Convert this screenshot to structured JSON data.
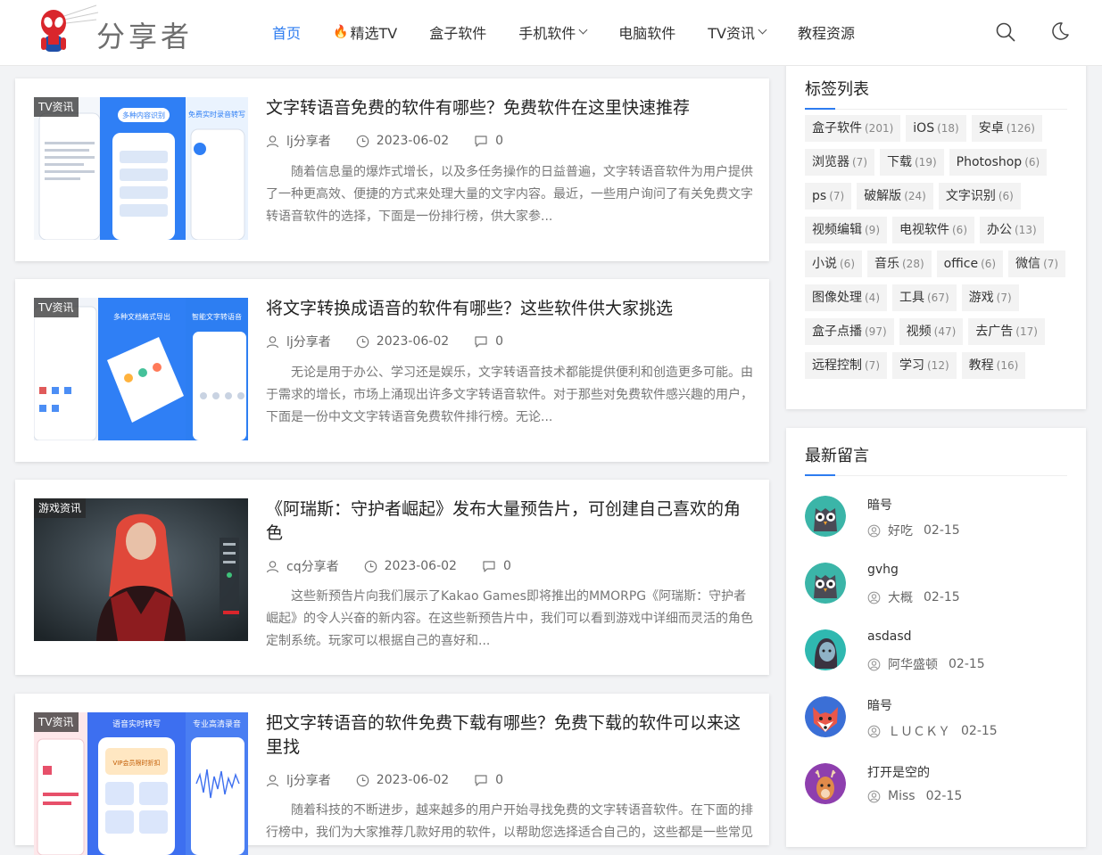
{
  "header": {
    "logo_text": "分享者",
    "nav": [
      {
        "label": "首页",
        "active": true,
        "hot": false,
        "dropdown": false
      },
      {
        "label": "精选TV",
        "active": false,
        "hot": true,
        "dropdown": false
      },
      {
        "label": "盒子软件",
        "active": false,
        "hot": false,
        "dropdown": false
      },
      {
        "label": "手机软件",
        "active": false,
        "hot": false,
        "dropdown": true
      },
      {
        "label": "电脑软件",
        "active": false,
        "hot": false,
        "dropdown": false
      },
      {
        "label": "TV资讯",
        "active": false,
        "hot": false,
        "dropdown": true
      },
      {
        "label": "教程资源",
        "active": false,
        "hot": false,
        "dropdown": false
      }
    ],
    "icons": [
      "search-icon",
      "moon-icon"
    ],
    "accent_color": "#2d7cf0"
  },
  "posts": [
    {
      "category": "TV资讯",
      "title": "文字转语音免费的软件有哪些？免费软件在这里快速推荐",
      "author": "lj分享者",
      "date": "2023-06-02",
      "comments": "0",
      "excerpt": "随着信息量的爆炸式增长，以及多任务操作的日益普遍，文字转语音软件为用户提供了一种更高效、便捷的方式来处理大量的文字内容。最近，一些用户询问了有关免费文字转语音软件的选择，下面是一份排行榜，供大家参...",
      "thumb_texts": [
        "多种内容识别",
        "免费实时录音转写"
      ]
    },
    {
      "category": "TV资讯",
      "title": "将文字转换成语音的软件有哪些？这些软件供大家挑选",
      "author": "lj分享者",
      "date": "2023-06-02",
      "comments": "0",
      "excerpt": "无论是用于办公、学习还是娱乐，文字转语音技术都能提供便利和创造更多可能。由于需求的增长，市场上涌现出许多文字转语音软件。对于那些对免费软件感兴趣的用户，下面是一份中文文字转语音免费软件排行榜。无论...",
      "thumb_texts": [
        "多种文档格式导出",
        "智能文字转语音"
      ]
    },
    {
      "category": "游戏资讯",
      "title": "《阿瑞斯：守护者崛起》发布大量预告片，可创建自己喜欢的角色",
      "author": "cq分享者",
      "date": "2023-06-02",
      "comments": "0",
      "excerpt": "这些新预告片向我们展示了Kakao Games即将推出的MMORPG《阿瑞斯：守护者崛起》的令人兴奋的新内容。在这些新预告片中，我们可以看到游戏中详细而灵活的角色定制系统。玩家可以根据自己的喜好和...",
      "thumb_texts": []
    },
    {
      "category": "TV资讯",
      "title": "把文字转语音的软件免费下载有哪些？免费下载的软件可以来这里找",
      "author": "lj分享者",
      "date": "2023-06-02",
      "comments": "0",
      "excerpt": "随着科技的不断进步，越来越多的用户开始寻找免费的文字转语音软件。在下面的排行榜中，我们为大家推荐几款好用的软件，以帮助您选择适合自己的，这些都是一些常见",
      "thumb_texts": [
        "语音实时转写",
        "专业高清录音",
        "VIP会员限时折扣"
      ]
    }
  ],
  "sidebar": {
    "tags_title": "标签列表",
    "tags": [
      {
        "name": "盒子软件",
        "count": "(201)"
      },
      {
        "name": "iOS",
        "count": "(18)"
      },
      {
        "name": "安卓",
        "count": "(126)"
      },
      {
        "name": "浏览器",
        "count": "(7)"
      },
      {
        "name": "下载",
        "count": "(19)"
      },
      {
        "name": "Photoshop",
        "count": "(6)"
      },
      {
        "name": "ps",
        "count": "(7)"
      },
      {
        "name": "破解版",
        "count": "(24)"
      },
      {
        "name": "文字识别",
        "count": "(6)"
      },
      {
        "name": "视频编辑",
        "count": "(9)"
      },
      {
        "name": "电视软件",
        "count": "(6)"
      },
      {
        "name": "办公",
        "count": "(13)"
      },
      {
        "name": "小说",
        "count": "(6)"
      },
      {
        "name": "音乐",
        "count": "(28)"
      },
      {
        "name": "office",
        "count": "(6)"
      },
      {
        "name": "微信",
        "count": "(7)"
      },
      {
        "name": "图像处理",
        "count": "(4)"
      },
      {
        "name": "工具",
        "count": "(67)"
      },
      {
        "name": "游戏",
        "count": "(7)"
      },
      {
        "name": "盒子点播",
        "count": "(97)"
      },
      {
        "name": "视频",
        "count": "(47)"
      },
      {
        "name": "去广告",
        "count": "(17)"
      },
      {
        "name": "远程控制",
        "count": "(7)"
      },
      {
        "name": "学习",
        "count": "(12)"
      },
      {
        "name": "教程",
        "count": "(16)"
      }
    ],
    "comments_title": "最新留言",
    "comments": [
      {
        "text": "暗号",
        "user": "好吃",
        "date": "02-15",
        "avatar_color": "#3bb5a8",
        "avatar_icon": "owl-avatar-icon"
      },
      {
        "text": "gvhg",
        "user": "大概",
        "date": "02-15",
        "avatar_color": "#3bb5a8",
        "avatar_icon": "owl-avatar-icon"
      },
      {
        "text": "asdasd",
        "user": "阿华盛顿",
        "date": "02-15",
        "avatar_color": "#2fb8b0",
        "avatar_icon": "face-avatar-icon"
      },
      {
        "text": "暗号",
        "user": "ＬＵＣＫＹ",
        "date": "02-15",
        "avatar_color": "#3b6fd6",
        "avatar_icon": "fox-avatar-icon"
      },
      {
        "text": "打开是空的",
        "user": "Miss",
        "date": "02-15",
        "avatar_color": "#8e3fae",
        "avatar_icon": "deer-avatar-icon"
      }
    ]
  }
}
